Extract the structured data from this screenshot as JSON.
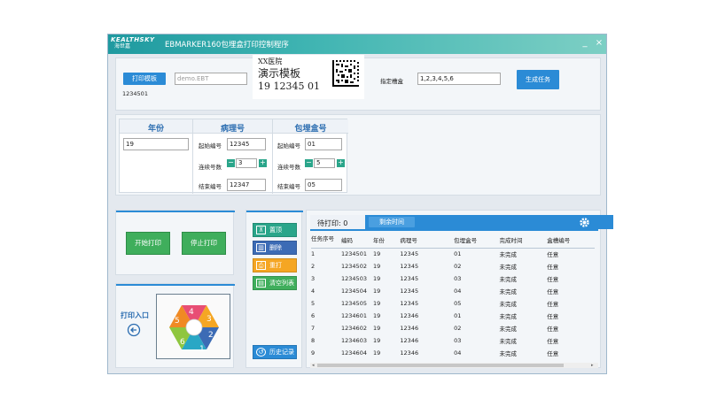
{
  "window": {
    "logo_top": "KEALTHSKY",
    "logo_bottom": "海世嘉",
    "title": "EBMARKER160包埋盒打印控制程序",
    "minimize": "_",
    "close": "×"
  },
  "template": {
    "button": "打印模板",
    "file_value": "demo.EBT",
    "number": "1234501",
    "preview_hospital": "XX医院",
    "preview_title": "演示模板",
    "preview_code": "19 12345 01"
  },
  "slot": {
    "label": "指定槽盒",
    "value": "1,2,3,4,5,6",
    "generate_button": "生成任务"
  },
  "year": {
    "header": "年份",
    "value": "19"
  },
  "pathology": {
    "header": "病理号",
    "start_label": "起始编号",
    "start_value": "12345",
    "count_label": "连续号数",
    "count_value": "3",
    "end_label": "结束编号",
    "end_value": "12347"
  },
  "cassette": {
    "header": "包埋盒号",
    "start_label": "起始编号",
    "start_value": "01",
    "count_label": "连续号数",
    "count_value": "5",
    "end_label": "结束编号",
    "end_value": "05"
  },
  "controls": {
    "start_print": "开始打印",
    "stop_print": "停止打印"
  },
  "entry": {
    "label": "打印入口",
    "segments": [
      "1",
      "2",
      "3",
      "4",
      "5",
      "6"
    ],
    "icon": "exit-arrow-icon"
  },
  "side_buttons": {
    "top": "置顶",
    "delete": "删除",
    "reprint": "重打",
    "clear": "清空列表",
    "history": "历史记录"
  },
  "queue": {
    "pending_label": "待打印: 0",
    "remaining_button": "剩余时间",
    "columns": [
      "任务序号",
      "编码",
      "年份",
      "病理号",
      "包埋盒号",
      "完成时间",
      "盒槽编号"
    ],
    "rows": [
      [
        "1",
        "1234501",
        "19",
        "12345",
        "01",
        "未完成",
        "任意"
      ],
      [
        "2",
        "1234502",
        "19",
        "12345",
        "02",
        "未完成",
        "任意"
      ],
      [
        "3",
        "1234503",
        "19",
        "12345",
        "03",
        "未完成",
        "任意"
      ],
      [
        "4",
        "1234504",
        "19",
        "12345",
        "04",
        "未完成",
        "任意"
      ],
      [
        "5",
        "1234505",
        "19",
        "12345",
        "05",
        "未完成",
        "任意"
      ],
      [
        "6",
        "1234601",
        "19",
        "12346",
        "01",
        "未完成",
        "任意"
      ],
      [
        "7",
        "1234602",
        "19",
        "12346",
        "02",
        "未完成",
        "任意"
      ],
      [
        "8",
        "1234603",
        "19",
        "12346",
        "03",
        "未完成",
        "任意"
      ],
      [
        "9",
        "1234604",
        "19",
        "12346",
        "04",
        "未完成",
        "任意"
      ]
    ]
  },
  "colors": {
    "title_bar": "#1f9aa0",
    "accent_blue": "#2b8bd6",
    "green": "#3fae5c",
    "orange": "#f5a623",
    "teal": "#2aa58a",
    "purple": "#6b4fa0",
    "hexagon": [
      "#e84e74",
      "#f5a623",
      "#8fc63f",
      "#29a7c5",
      "#3c6bb5",
      "#7b4fa6"
    ]
  }
}
